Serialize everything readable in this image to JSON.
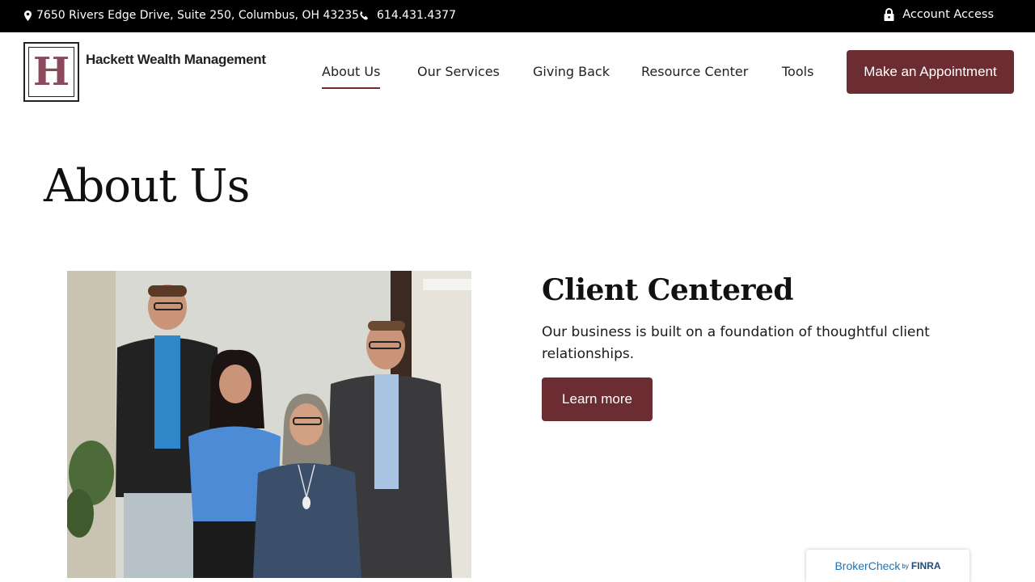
{
  "topbar": {
    "address": "7650 Rivers Edge Drive, Suite 250, Columbus, OH 43235",
    "phone": "614.431.4377",
    "account": "Account Access"
  },
  "header": {
    "logo_letter": "H",
    "brand": "Hackett Wealth Management",
    "nav": [
      "About Us",
      "Our Services",
      "Giving Back",
      "Resource Center",
      "Tools"
    ],
    "active_nav": "About Us",
    "cta": "Make an Appointment"
  },
  "main": {
    "page_title": "About Us",
    "section_title": "Client Centered",
    "section_text": "Our business is built on a foundation of thoughtful client relationships.",
    "learn_more": "Learn more"
  },
  "broker_check": {
    "broker": "Broker",
    "check": "Check",
    "by": "by",
    "finra": "FINRA"
  },
  "colors": {
    "topbar_bg": "#000000",
    "accent": "#6b2c32",
    "logo_letter": "#8b4a5c",
    "broker_blue": "#1f74b5"
  }
}
